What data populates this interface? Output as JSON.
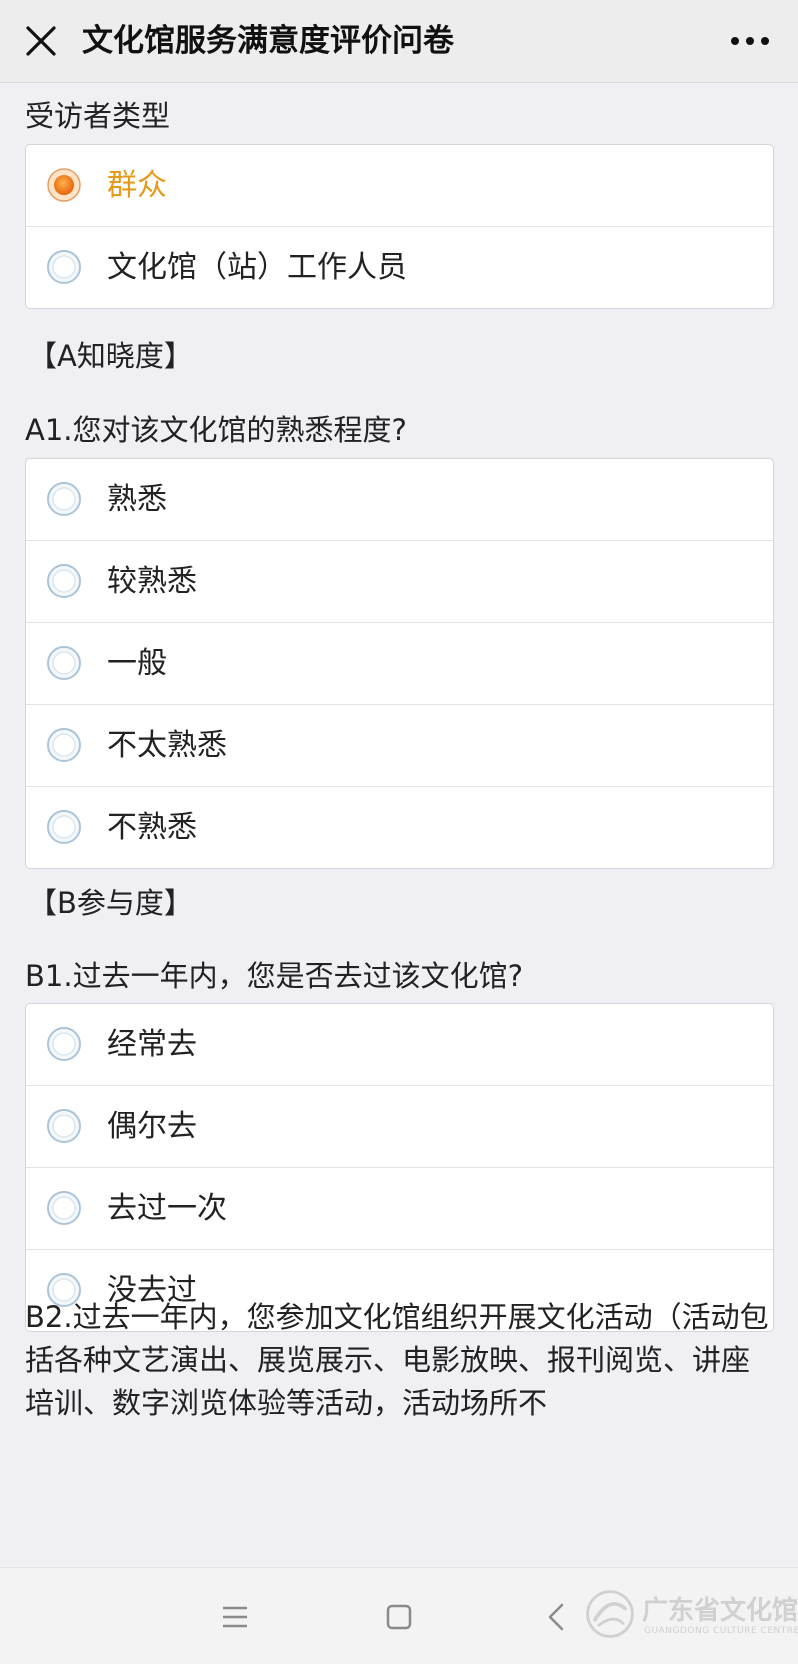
{
  "header": {
    "title": "文化馆服务满意度评价问卷",
    "close_icon": "close-icon",
    "more_icon": "more-dots-icon"
  },
  "questions": {
    "respondent_type": {
      "title": "受访者类型",
      "options": [
        {
          "label": "群众",
          "selected": true
        },
        {
          "label": "文化馆（站）工作人员",
          "selected": false
        }
      ]
    },
    "section_a": "【A知晓度】",
    "a1": {
      "title": "A1.您对该文化馆的熟悉程度?",
      "options": [
        {
          "label": "熟悉",
          "selected": false
        },
        {
          "label": "较熟悉",
          "selected": false
        },
        {
          "label": "一般",
          "selected": false
        },
        {
          "label": "不太熟悉",
          "selected": false
        },
        {
          "label": "不熟悉",
          "selected": false
        }
      ]
    },
    "section_b": "【B参与度】",
    "b1": {
      "title": "B1.过去一年内，您是否去过该文化馆?",
      "options": [
        {
          "label": "经常去",
          "selected": false
        },
        {
          "label": "偶尔去",
          "selected": false
        },
        {
          "label": "去过一次",
          "selected": false
        },
        {
          "label": "没去过",
          "selected": false
        }
      ]
    },
    "b2": {
      "title": "B2.过去一年内，您参加文化馆组织开展文化活动（活动包括各种文艺演出、展览展示、电影放映、报刊阅览、讲座培训、数字浏览体验等活动，活动场所不"
    }
  },
  "navbar": {
    "menu_icon": "menu-icon",
    "home_icon": "home-square-icon",
    "back_icon": "back-chevron-icon"
  },
  "watermark": {
    "text": "广东省文化馆",
    "subtext": "GUANGDONG CULTURE CENTRE"
  },
  "colors": {
    "accent": "#e59a1a",
    "radio_selected": "#f07820",
    "radio_unselected": "#b7cde0"
  }
}
